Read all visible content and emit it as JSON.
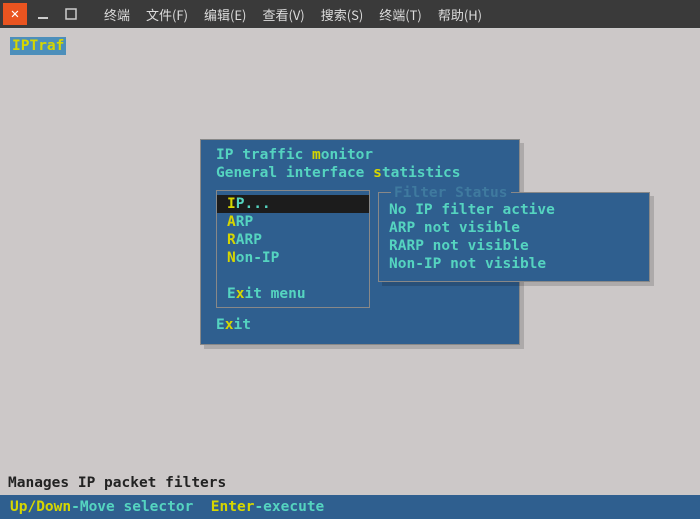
{
  "window": {
    "title": "终端"
  },
  "menubar": {
    "items": [
      "终端",
      "文件(F)",
      "编辑(E)",
      "查看(V)",
      "搜索(S)",
      "终端(T)",
      "帮助(H)"
    ]
  },
  "app": {
    "name": "IPTraf"
  },
  "dialog": {
    "line1_pre": "IP traffic ",
    "line1_hot": "m",
    "line1_post": "onitor",
    "line2_pre": "General interface ",
    "line2_hot": "s",
    "line2_post": "tatistics",
    "exit_pre": "E",
    "exit_hot": "x",
    "exit_post": "it"
  },
  "submenu": {
    "items": [
      {
        "hot": "I",
        "rest": "P...",
        "selected": true
      },
      {
        "hot": "A",
        "rest": "RP",
        "selected": false
      },
      {
        "hot": "R",
        "rest": "ARP",
        "selected": false
      },
      {
        "hot": "N",
        "rest": "on-IP",
        "selected": false
      }
    ],
    "exit_pre": "E",
    "exit_hot": "x",
    "exit_post": "it menu"
  },
  "filter": {
    "title": " Filter Status ",
    "lines": [
      "No IP filter active",
      "ARP not visible",
      "RARP not visible",
      "Non-IP not visible"
    ]
  },
  "status": {
    "text": "Manages IP packet filters"
  },
  "help": {
    "key1": "Up/Down",
    "text1": "-Move selector  ",
    "key2": "Enter",
    "text2": "-execute"
  }
}
